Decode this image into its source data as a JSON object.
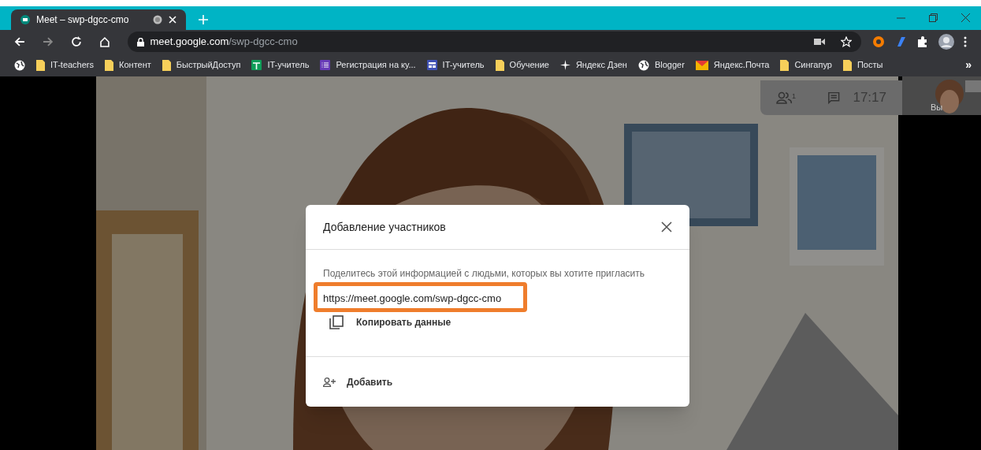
{
  "tab": {
    "title": "Meet – swp-dgcc-cmo",
    "recording": true
  },
  "address": {
    "host": "meet.google.com",
    "path": "/swp-dgcc-cmo"
  },
  "bookmarks": [
    {
      "kind": "globe"
    },
    {
      "label": "IT-teachers",
      "kind": "folder"
    },
    {
      "label": "Контент",
      "kind": "folder"
    },
    {
      "label": "БыстрыйДоступ",
      "kind": "folder"
    },
    {
      "label": "IT-учитель",
      "kind": "sheets"
    },
    {
      "label": "Регистрация на ку...",
      "kind": "forms"
    },
    {
      "label": "IT-учитель",
      "kind": "slides"
    },
    {
      "label": "Обучение",
      "kind": "folder"
    },
    {
      "label": "Яндекс Дзен",
      "kind": "sparkle"
    },
    {
      "label": "Blogger",
      "kind": "globe"
    },
    {
      "label": "Яндекс.Почта",
      "kind": "mail"
    },
    {
      "label": "Сингапур",
      "kind": "folder"
    },
    {
      "label": "Посты",
      "kind": "folder"
    }
  ],
  "bookmarks_more": "»",
  "meeting": {
    "participants_count": "1",
    "time": "17:17",
    "self_label": "Вы"
  },
  "dialog": {
    "title": "Добавление участников",
    "hint": "Поделитесь этой информацией с людьми, которых вы хотите пригласить",
    "link": "https://meet.google.com/swp-dgcc-cmo",
    "link_highlighted": true,
    "copy": "Копировать данные",
    "add": "Добавить"
  }
}
